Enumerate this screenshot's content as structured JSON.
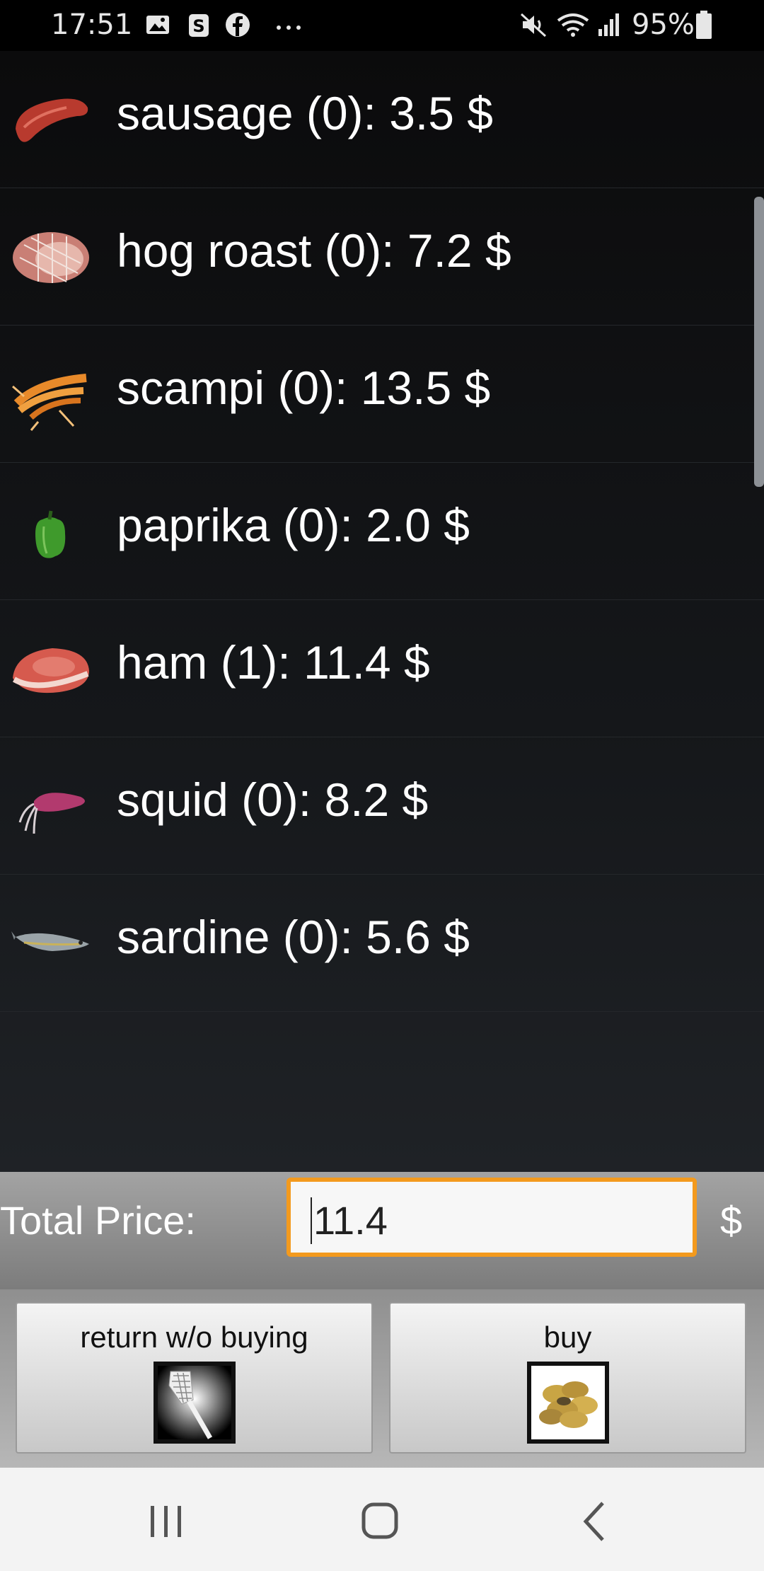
{
  "status_bar": {
    "time": "17:51",
    "battery": "95%",
    "icons": [
      "gallery-icon",
      "s-app-icon",
      "facebook-icon",
      "more-icon",
      "mute-icon",
      "wifi-icon",
      "signal-icon",
      "battery-icon"
    ]
  },
  "items": [
    {
      "label": "sausage (0): 3.5 $",
      "icon": "sausage-image"
    },
    {
      "label": "hog roast (0): 7.2 $",
      "icon": "hog-roast-image"
    },
    {
      "label": "scampi (0): 13.5 $",
      "icon": "scampi-image"
    },
    {
      "label": "paprika (0): 2.0 $",
      "icon": "paprika-image"
    },
    {
      "label": "ham (1): 11.4 $",
      "icon": "ham-image"
    },
    {
      "label": "squid (0): 8.2 $",
      "icon": "squid-image"
    },
    {
      "label": "sardine (0): 5.6 $",
      "icon": "sardine-image"
    }
  ],
  "total": {
    "label": "Total Price:",
    "value": "11.4",
    "currency": "$"
  },
  "buttons": {
    "return_label": "return w/o buying",
    "buy_label": "buy"
  },
  "nav": [
    "recents-icon",
    "home-icon",
    "back-icon"
  ],
  "colors": {
    "input_border": "#f39a1e",
    "list_bg": "#15171a"
  }
}
